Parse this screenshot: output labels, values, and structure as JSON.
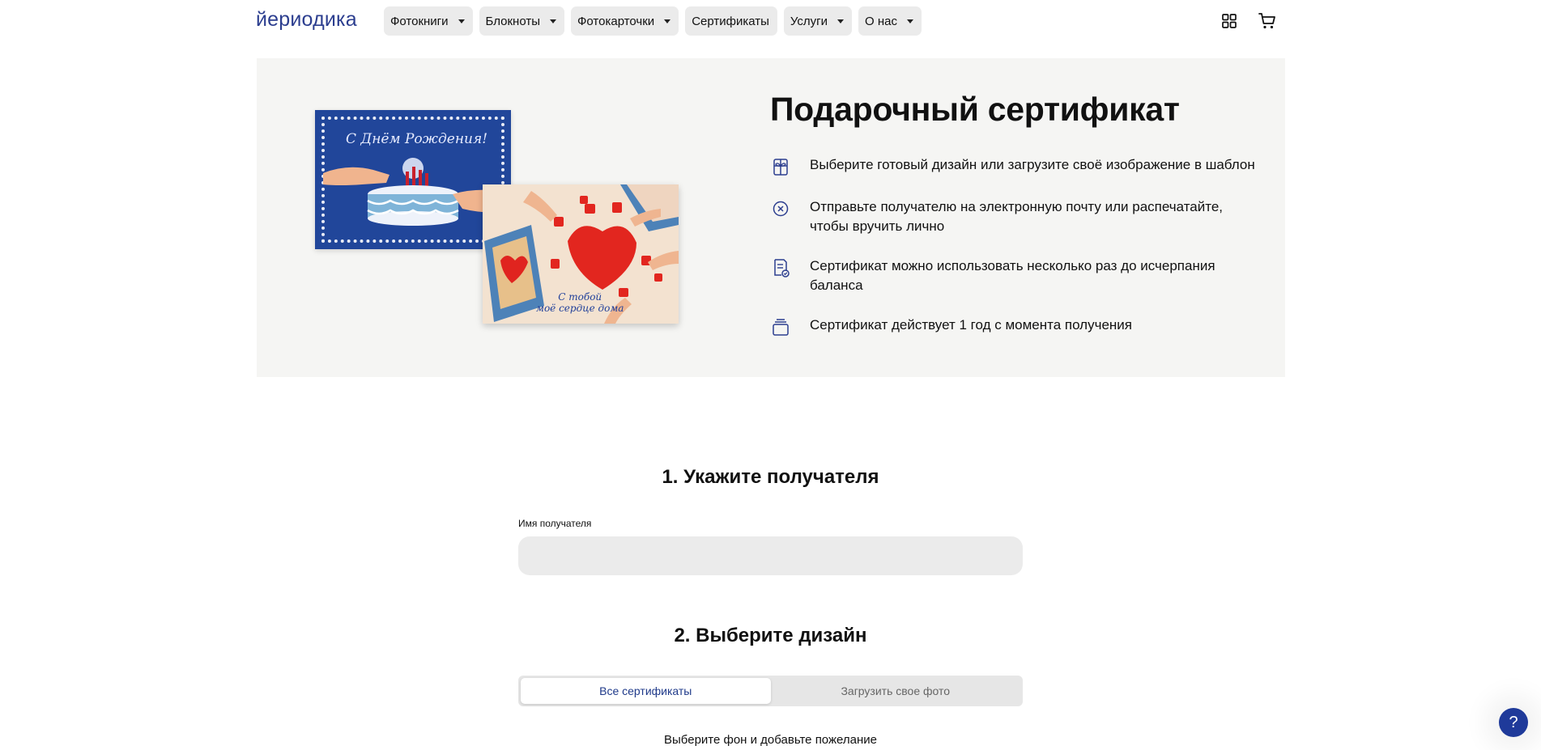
{
  "header": {
    "logo": "йериодика",
    "nav": [
      {
        "label": "Фотокниги",
        "has_dropdown": true
      },
      {
        "label": "Блокноты",
        "has_dropdown": true
      },
      {
        "label": "Фотокарточки",
        "has_dropdown": true
      },
      {
        "label": "Сертификаты",
        "has_dropdown": false
      },
      {
        "label": "Услуги",
        "has_dropdown": true
      },
      {
        "label": "О нас",
        "has_dropdown": true
      }
    ],
    "icons": [
      "grid-icon",
      "cart-icon"
    ]
  },
  "hero": {
    "title": "Подарочный сертификат",
    "card1_text": "С Днём Рождения!",
    "card2_text_line1": "С тобой",
    "card2_text_line2": "моё сердце дома",
    "features": [
      {
        "icon": "gift-icon",
        "text": "Выберите готовый дизайн или загрузите своё изображение в шаблон"
      },
      {
        "icon": "send-icon",
        "text": "Отправьте получателю на электронную почту или распечатайте, чтобы вручить лично"
      },
      {
        "icon": "receipt-icon",
        "text": "Сертификат можно использовать несколько раз до исчерпания баланса"
      },
      {
        "icon": "stack-icon",
        "text": "Сертификат действует 1 год с момента получения"
      }
    ]
  },
  "step1": {
    "title": "1. Укажите получателя",
    "label": "Имя получателя",
    "value": ""
  },
  "step2": {
    "title": "2. Выберите дизайн",
    "tabs": [
      {
        "label": "Все сертификаты",
        "active": true
      },
      {
        "label": "Загрузить свое фото",
        "active": false
      }
    ],
    "hint": "Выберите фон и добавьте пожелание"
  },
  "help": {
    "label": "?"
  },
  "colors": {
    "brand": "#2c3e8f",
    "hero_bg": "#f5f5f3",
    "nav_bg": "#ebebeb",
    "help_bg": "#1f3a9a"
  }
}
